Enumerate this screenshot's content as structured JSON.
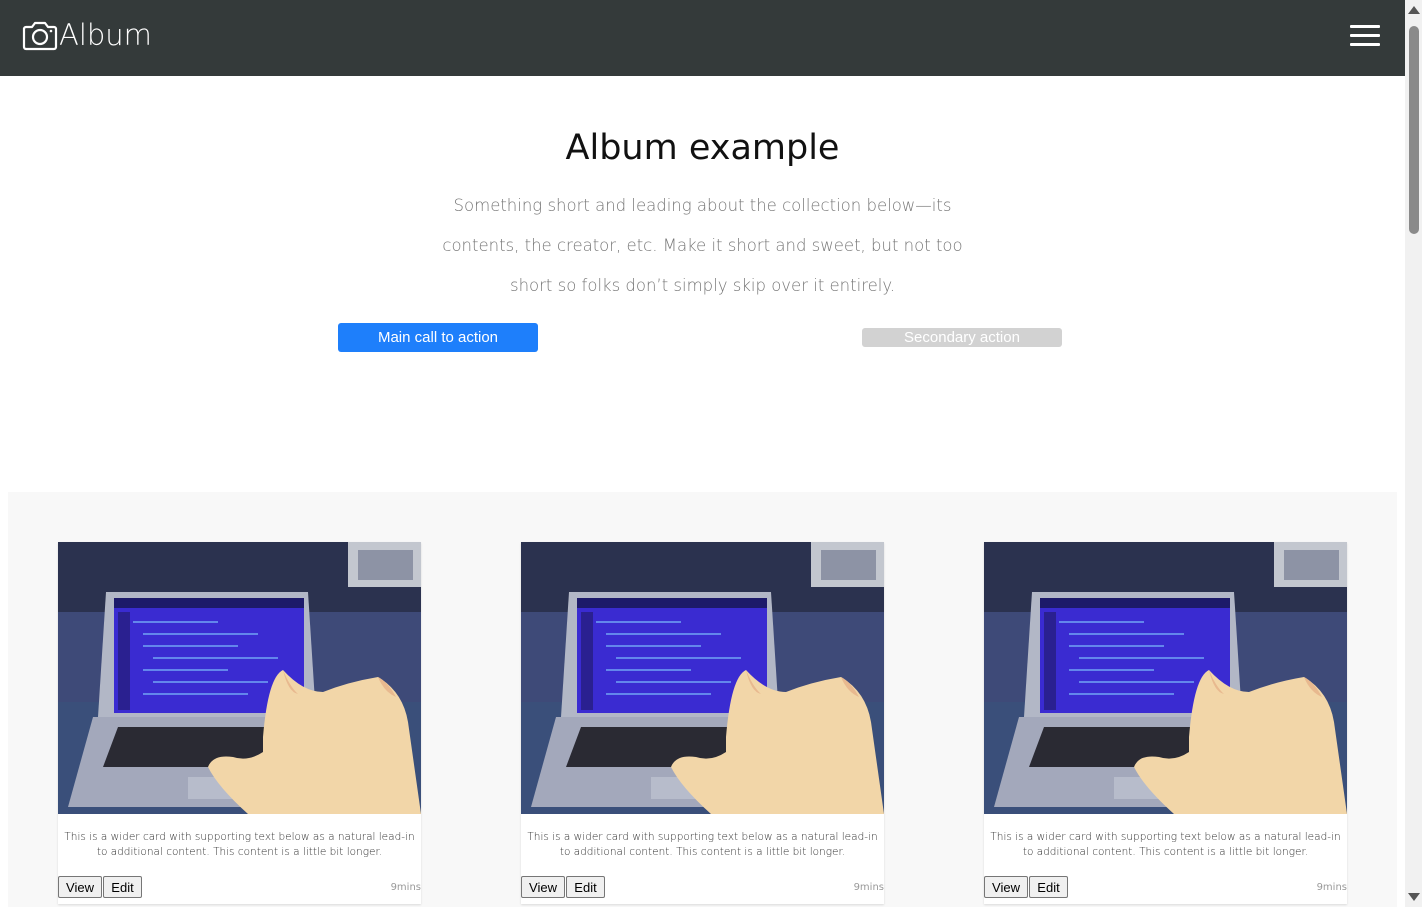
{
  "navbar": {
    "brand": "Album",
    "colors": {
      "background": "#343a3a",
      "text": "#ffffff"
    }
  },
  "hero": {
    "title": "Album example",
    "lead": "Something short and leading about the collection below—its contents, the creator, etc. Make it short and sweet, but not too short so folks don’t simply skip over it entirely.",
    "primary_button": "Main call to action",
    "secondary_button": "Secondary action",
    "colors": {
      "primary": "#1e7ffb",
      "secondary": "#d2d2d2"
    }
  },
  "cards": [
    {
      "text": "This is a wider card with supporting text below as a natural lead-in to additional content. This content is a little bit longer.",
      "view_label": "View",
      "edit_label": "Edit",
      "time": "9mins"
    },
    {
      "text": "This is a wider card with supporting text below as a natural lead-in to additional content. This content is a little bit longer.",
      "view_label": "View",
      "edit_label": "Edit",
      "time": "9mins"
    },
    {
      "text": "This is a wider card with supporting text below as a natural lead-in to additional content. This content is a little bit longer.",
      "view_label": "View",
      "edit_label": "Edit",
      "time": "9mins"
    }
  ],
  "icons": {
    "brand": "camera-icon",
    "menu": "hamburger-menu-icon",
    "card_image": "cat-at-laptop-image"
  }
}
